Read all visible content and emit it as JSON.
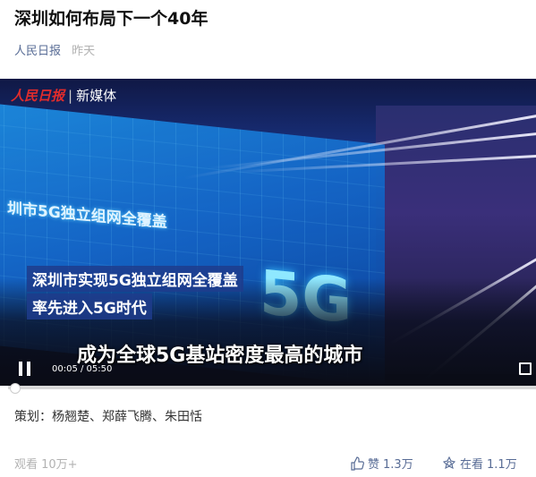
{
  "article": {
    "title": "深圳如何布局下一个40年",
    "source": "人民日报",
    "time": "昨天"
  },
  "video": {
    "logo_brand": "人民日报",
    "logo_sub": "新媒体",
    "stage_text": "圳市5G独立组网全覆盖",
    "stage_big": "5G",
    "caption_line1": "深圳市实现5G独立组网全覆盖",
    "caption_line2": "率先进入5G时代",
    "caption_main": "成为全球5G基站密度最高的城市",
    "timecode": "00:05 / 05:50",
    "progress": 0.0143
  },
  "credits": "策划：杨翘楚、郑薛飞腾、朱田恬",
  "footer": {
    "views": "观看 10万+",
    "like_label": "赞",
    "like_count": "1.3万",
    "watch_label": "在看",
    "watch_count": "1.1万"
  },
  "colors": {
    "link": "#576b95",
    "muted": "#b2b2b2"
  }
}
